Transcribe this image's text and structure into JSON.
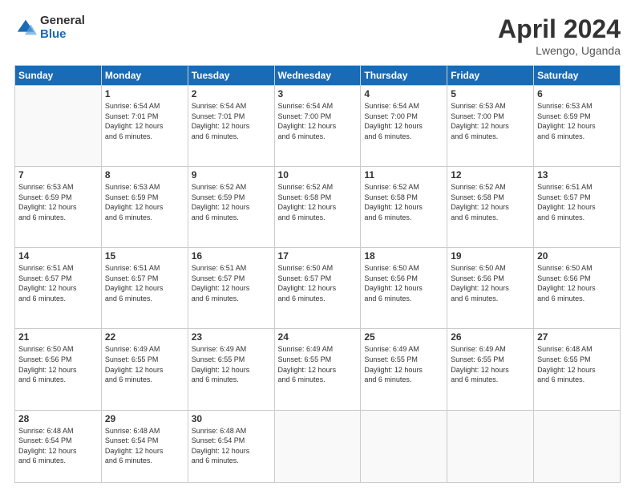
{
  "logo": {
    "general": "General",
    "blue": "Blue"
  },
  "title": {
    "month": "April 2024",
    "location": "Lwengo, Uganda"
  },
  "days_of_week": [
    "Sunday",
    "Monday",
    "Tuesday",
    "Wednesday",
    "Thursday",
    "Friday",
    "Saturday"
  ],
  "weeks": [
    [
      {
        "day": "",
        "info": ""
      },
      {
        "day": "1",
        "info": "Sunrise: 6:54 AM\nSunset: 7:01 PM\nDaylight: 12 hours\nand 6 minutes."
      },
      {
        "day": "2",
        "info": "Sunrise: 6:54 AM\nSunset: 7:01 PM\nDaylight: 12 hours\nand 6 minutes."
      },
      {
        "day": "3",
        "info": "Sunrise: 6:54 AM\nSunset: 7:00 PM\nDaylight: 12 hours\nand 6 minutes."
      },
      {
        "day": "4",
        "info": "Sunrise: 6:54 AM\nSunset: 7:00 PM\nDaylight: 12 hours\nand 6 minutes."
      },
      {
        "day": "5",
        "info": "Sunrise: 6:53 AM\nSunset: 7:00 PM\nDaylight: 12 hours\nand 6 minutes."
      },
      {
        "day": "6",
        "info": "Sunrise: 6:53 AM\nSunset: 6:59 PM\nDaylight: 12 hours\nand 6 minutes."
      }
    ],
    [
      {
        "day": "7",
        "info": "Sunrise: 6:53 AM\nSunset: 6:59 PM\nDaylight: 12 hours\nand 6 minutes."
      },
      {
        "day": "8",
        "info": "Sunrise: 6:53 AM\nSunset: 6:59 PM\nDaylight: 12 hours\nand 6 minutes."
      },
      {
        "day": "9",
        "info": "Sunrise: 6:52 AM\nSunset: 6:59 PM\nDaylight: 12 hours\nand 6 minutes."
      },
      {
        "day": "10",
        "info": "Sunrise: 6:52 AM\nSunset: 6:58 PM\nDaylight: 12 hours\nand 6 minutes."
      },
      {
        "day": "11",
        "info": "Sunrise: 6:52 AM\nSunset: 6:58 PM\nDaylight: 12 hours\nand 6 minutes."
      },
      {
        "day": "12",
        "info": "Sunrise: 6:52 AM\nSunset: 6:58 PM\nDaylight: 12 hours\nand 6 minutes."
      },
      {
        "day": "13",
        "info": "Sunrise: 6:51 AM\nSunset: 6:57 PM\nDaylight: 12 hours\nand 6 minutes."
      }
    ],
    [
      {
        "day": "14",
        "info": "Sunrise: 6:51 AM\nSunset: 6:57 PM\nDaylight: 12 hours\nand 6 minutes."
      },
      {
        "day": "15",
        "info": "Sunrise: 6:51 AM\nSunset: 6:57 PM\nDaylight: 12 hours\nand 6 minutes."
      },
      {
        "day": "16",
        "info": "Sunrise: 6:51 AM\nSunset: 6:57 PM\nDaylight: 12 hours\nand 6 minutes."
      },
      {
        "day": "17",
        "info": "Sunrise: 6:50 AM\nSunset: 6:57 PM\nDaylight: 12 hours\nand 6 minutes."
      },
      {
        "day": "18",
        "info": "Sunrise: 6:50 AM\nSunset: 6:56 PM\nDaylight: 12 hours\nand 6 minutes."
      },
      {
        "day": "19",
        "info": "Sunrise: 6:50 AM\nSunset: 6:56 PM\nDaylight: 12 hours\nand 6 minutes."
      },
      {
        "day": "20",
        "info": "Sunrise: 6:50 AM\nSunset: 6:56 PM\nDaylight: 12 hours\nand 6 minutes."
      }
    ],
    [
      {
        "day": "21",
        "info": "Sunrise: 6:50 AM\nSunset: 6:56 PM\nDaylight: 12 hours\nand 6 minutes."
      },
      {
        "day": "22",
        "info": "Sunrise: 6:49 AM\nSunset: 6:55 PM\nDaylight: 12 hours\nand 6 minutes."
      },
      {
        "day": "23",
        "info": "Sunrise: 6:49 AM\nSunset: 6:55 PM\nDaylight: 12 hours\nand 6 minutes."
      },
      {
        "day": "24",
        "info": "Sunrise: 6:49 AM\nSunset: 6:55 PM\nDaylight: 12 hours\nand 6 minutes."
      },
      {
        "day": "25",
        "info": "Sunrise: 6:49 AM\nSunset: 6:55 PM\nDaylight: 12 hours\nand 6 minutes."
      },
      {
        "day": "26",
        "info": "Sunrise: 6:49 AM\nSunset: 6:55 PM\nDaylight: 12 hours\nand 6 minutes."
      },
      {
        "day": "27",
        "info": "Sunrise: 6:48 AM\nSunset: 6:55 PM\nDaylight: 12 hours\nand 6 minutes."
      }
    ],
    [
      {
        "day": "28",
        "info": "Sunrise: 6:48 AM\nSunset: 6:54 PM\nDaylight: 12 hours\nand 6 minutes."
      },
      {
        "day": "29",
        "info": "Sunrise: 6:48 AM\nSunset: 6:54 PM\nDaylight: 12 hours\nand 6 minutes."
      },
      {
        "day": "30",
        "info": "Sunrise: 6:48 AM\nSunset: 6:54 PM\nDaylight: 12 hours\nand 6 minutes."
      },
      {
        "day": "",
        "info": ""
      },
      {
        "day": "",
        "info": ""
      },
      {
        "day": "",
        "info": ""
      },
      {
        "day": "",
        "info": ""
      }
    ]
  ]
}
